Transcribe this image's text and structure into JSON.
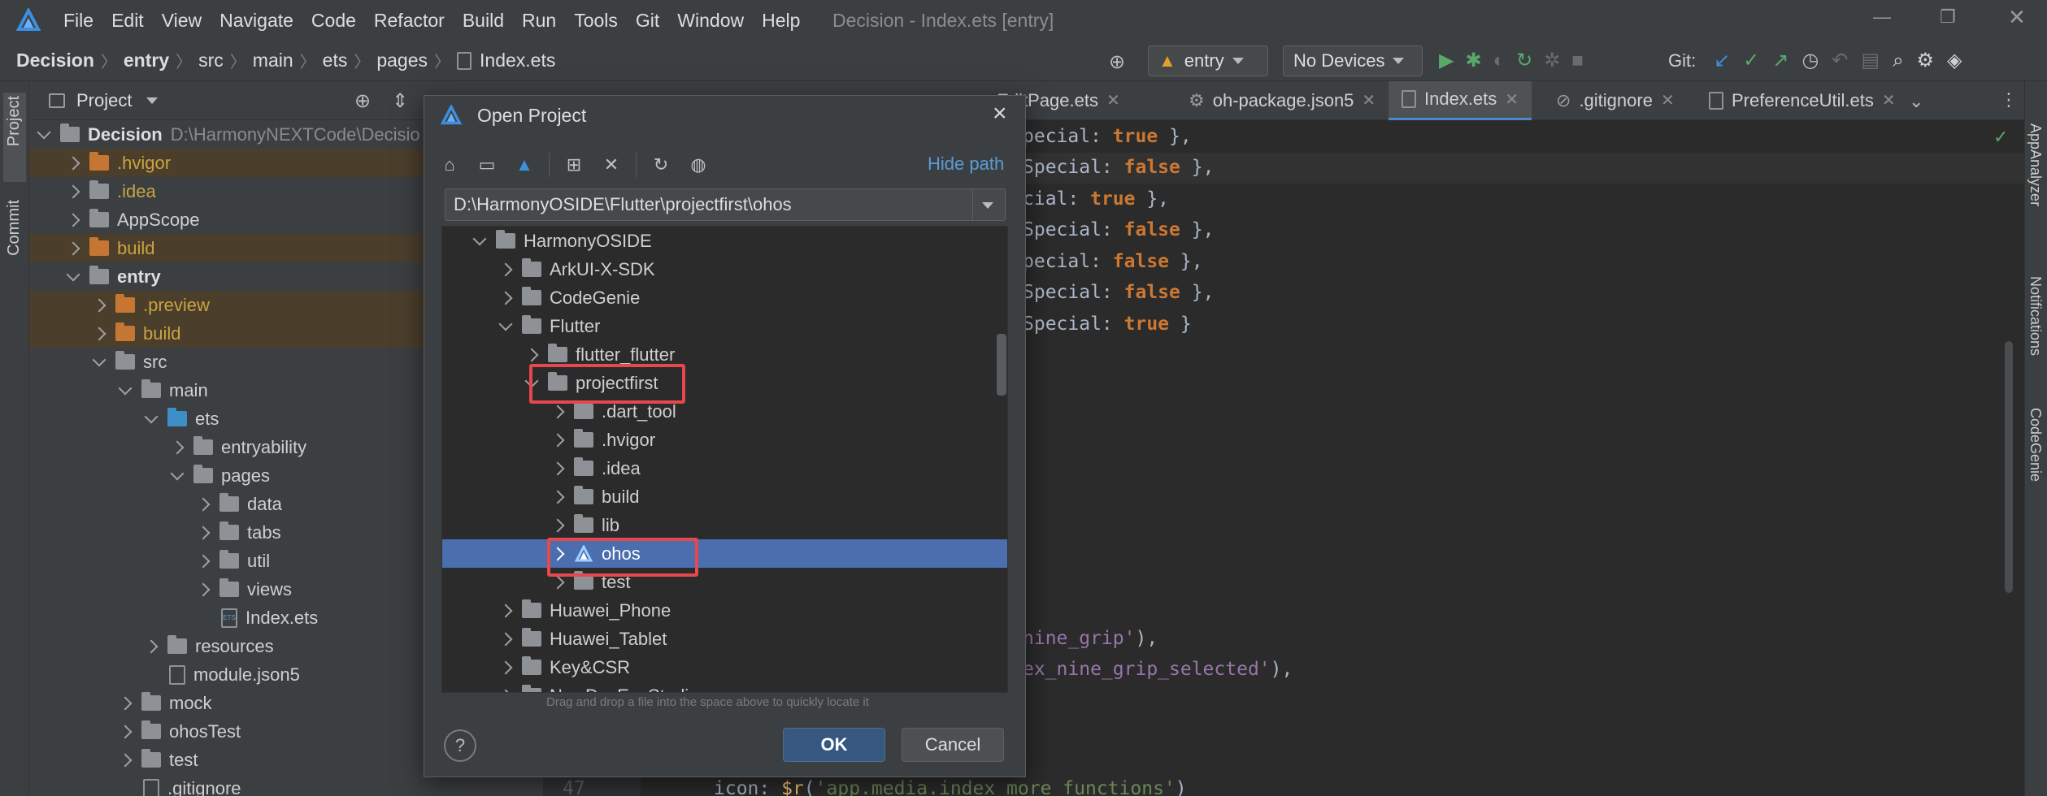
{
  "titlebar": {
    "menus": [
      "File",
      "Edit",
      "View",
      "Navigate",
      "Code",
      "Refactor",
      "Build",
      "Run",
      "Tools",
      "Git",
      "Window",
      "Help"
    ],
    "window_title": "Decision - Index.ets [entry]"
  },
  "navbar": {
    "breadcrumbs": [
      "Decision",
      "entry",
      "src",
      "main",
      "ets",
      "pages",
      "Index.ets"
    ],
    "run_config": "entry",
    "device": "No Devices",
    "git_label": "Git:"
  },
  "left_stripe": {
    "project": "Project",
    "commit": "Commit"
  },
  "project_panel": {
    "header": "Project",
    "tree": [
      {
        "label": "Decision",
        "extra": "D:\\HarmonyNEXTCode\\Decisio"
      },
      {
        "label": ".hvigor"
      },
      {
        "label": ".idea"
      },
      {
        "label": "AppScope"
      },
      {
        "label": "build"
      },
      {
        "label": "entry"
      },
      {
        "label": ".preview"
      },
      {
        "label": "build"
      },
      {
        "label": "src"
      },
      {
        "label": "main"
      },
      {
        "label": "ets"
      },
      {
        "label": "entryability"
      },
      {
        "label": "pages"
      },
      {
        "label": "data"
      },
      {
        "label": "tabs"
      },
      {
        "label": "util"
      },
      {
        "label": "views"
      },
      {
        "label": "Index.ets"
      },
      {
        "label": "resources"
      },
      {
        "label": "module.json5"
      },
      {
        "label": "mock"
      },
      {
        "label": "ohosTest"
      },
      {
        "label": "test"
      },
      {
        "label": ".gitignore"
      }
    ]
  },
  "editor": {
    "tabs": [
      {
        "label": "eEditPage.ets"
      },
      {
        "label": "oh-package.json5"
      },
      {
        "label": "Index.ets"
      },
      {
        "label": ".gitignore"
      },
      {
        "label": "PreferenceUtil.ets"
      }
    ],
    "lines": [
      {
        "pre": "pecial: ",
        "kw": "true",
        "post": " },"
      },
      {
        "pre": "Special: ",
        "kw": "false",
        "post": " },"
      },
      {
        "pre": "cial: ",
        "kw": "true",
        "post": " },"
      },
      {
        "pre": "Special: ",
        "kw": "false",
        "post": " },"
      },
      {
        "pre": "pecial: ",
        "kw": "false",
        "post": " },"
      },
      {
        "pre": "Special: ",
        "kw": "false",
        "post": " },"
      },
      {
        "pre": "Special: ",
        "kw": "true",
        "post": " }"
      }
    ],
    "lower_lines": [
      {
        "str": "nine_grip'",
        "post": "),"
      },
      {
        "str": "ex_nine_grip_selected'",
        "post": "),"
      }
    ],
    "bottom_line": {
      "num": "47",
      "kw": "icon",
      "fn": "$r",
      "str": "'app.media.index_more_functions'",
      "post": ")"
    }
  },
  "right_stripe": [
    "AppAnalyzer",
    "Notifications",
    "CodeGenie"
  ],
  "dialog": {
    "title": "Open Project",
    "hide_path": "Hide path",
    "path": "D:\\HarmonyOSIDE\\Flutter\\projectfirst\\ohos",
    "tree": [
      {
        "label": "HarmonyOSIDE"
      },
      {
        "label": "ArkUI-X-SDK"
      },
      {
        "label": "CodeGenie"
      },
      {
        "label": "Flutter"
      },
      {
        "label": "flutter_flutter"
      },
      {
        "label": "projectfirst"
      },
      {
        "label": ".dart_tool"
      },
      {
        "label": ".hvigor"
      },
      {
        "label": ".idea"
      },
      {
        "label": "build"
      },
      {
        "label": "lib"
      },
      {
        "label": "ohos"
      },
      {
        "label": "test"
      },
      {
        "label": "Huawei_Phone"
      },
      {
        "label": "Huawei_Tablet"
      },
      {
        "label": "Key&CSR"
      },
      {
        "label": "NewDevEcoStudio"
      }
    ],
    "hint": "Drag and drop a file into the space above to quickly locate it",
    "ok": "OK",
    "cancel": "Cancel",
    "help": "?"
  }
}
